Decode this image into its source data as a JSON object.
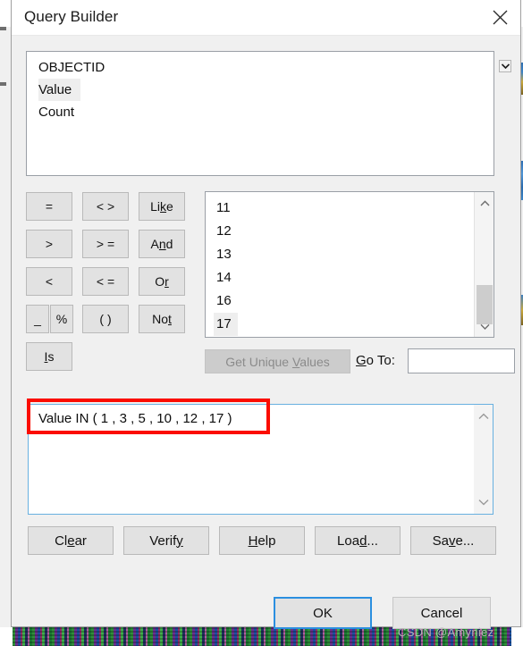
{
  "window": {
    "title": "Query Builder",
    "close_icon": "close-icon"
  },
  "field_list": {
    "items": [
      {
        "label": "OBJECTID",
        "selected": false
      },
      {
        "label": "Value",
        "selected": true
      },
      {
        "label": "Count",
        "selected": false
      }
    ],
    "dropdown_icon": "chevron-down-icon"
  },
  "operators": {
    "row1": [
      "=",
      "< >",
      "Like"
    ],
    "row2": [
      ">",
      "> =",
      "And"
    ],
    "row3": [
      "<",
      "< =",
      "Or"
    ],
    "row4": [
      "_",
      "%",
      "( )",
      "Not"
    ],
    "row5": [
      "Is"
    ],
    "accelerators": {
      "like": "k",
      "and": "n",
      "or": "r",
      "not": "t",
      "is": "I"
    }
  },
  "values_list": {
    "items": [
      {
        "label": "11",
        "selected": false
      },
      {
        "label": "12",
        "selected": false
      },
      {
        "label": "13",
        "selected": false
      },
      {
        "label": "14",
        "selected": false
      },
      {
        "label": "16",
        "selected": false
      },
      {
        "label": "17",
        "selected": true
      }
    ],
    "scroll_up_icon": "chevron-up-icon",
    "scroll_down_icon": "chevron-down-icon"
  },
  "unique": {
    "button_label": "Get Unique Values",
    "button_enabled": false,
    "goto_label": "Go To:",
    "goto_value": "",
    "goto_placeholder": ""
  },
  "query": {
    "text": "Value IN ( 1 , 3 , 5 , 10 , 12 , 17 )",
    "annotation_color": "#fb0d00",
    "scroll_up_icon": "chevron-up-icon",
    "scroll_down_icon": "chevron-down-icon"
  },
  "actions": {
    "clear": "Clear",
    "verify": "Verify",
    "help": "Help",
    "load": "Load...",
    "save": "Save..."
  },
  "footer": {
    "ok": "OK",
    "cancel": "Cancel",
    "focus_color": "#2b8fe0"
  },
  "watermark": {
    "text": "CSDN @Amyniez"
  }
}
